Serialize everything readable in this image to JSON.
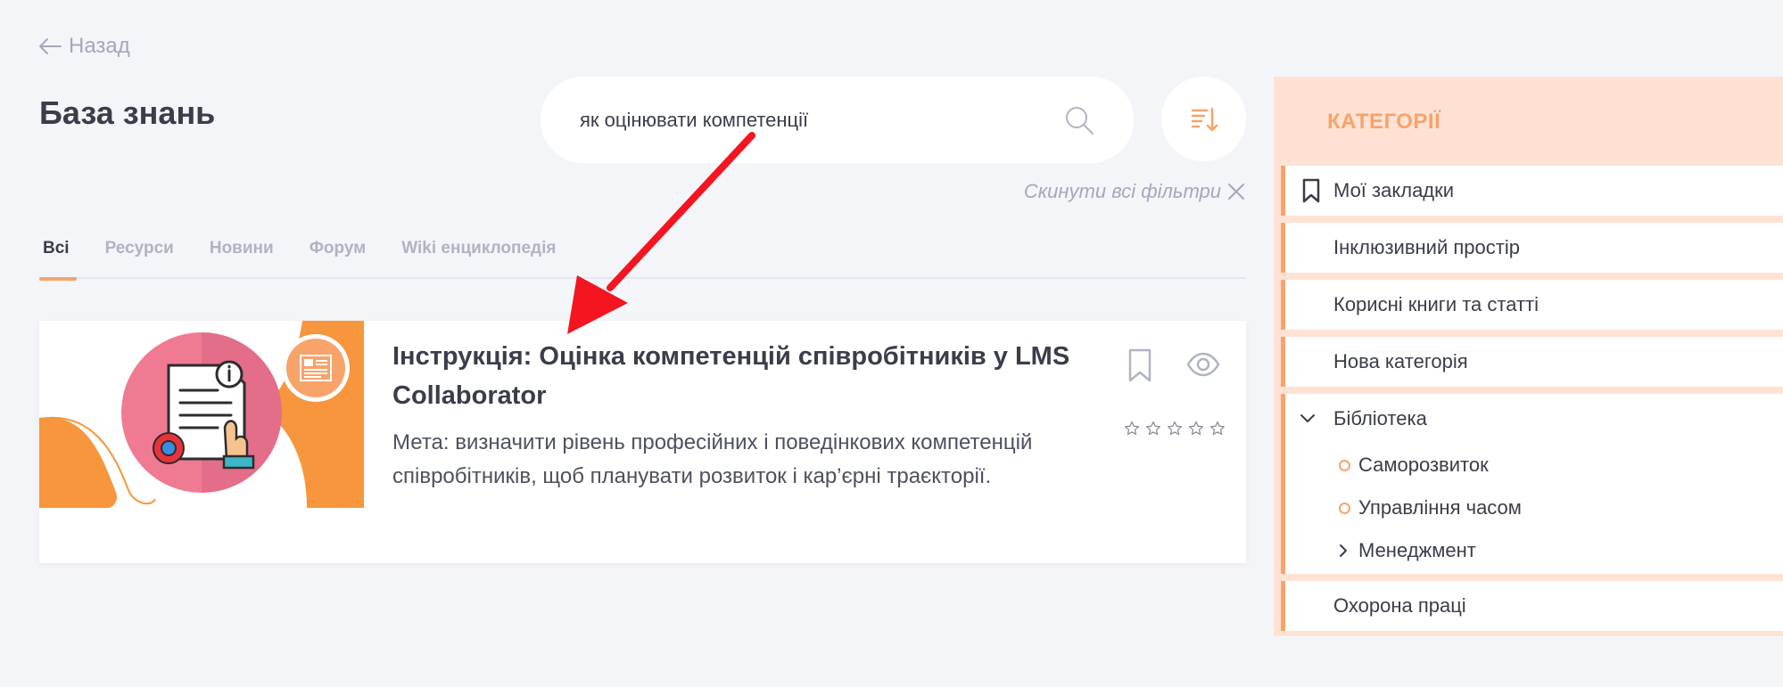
{
  "nav": {
    "back_label": "Назад"
  },
  "page": {
    "title": "База знань"
  },
  "search": {
    "value": "як оцінювати компетенції",
    "placeholder": ""
  },
  "filters": {
    "reset_label": "Скинути всі фільтри"
  },
  "tabs": [
    {
      "label": "Всі",
      "active": true
    },
    {
      "label": "Ресурси",
      "active": false
    },
    {
      "label": "Новини",
      "active": false
    },
    {
      "label": "Форум",
      "active": false
    },
    {
      "label": "Wiki енциклопедія",
      "active": false
    }
  ],
  "result": {
    "title": "Інструкція: Оцінка компетенцій співробітників у LMS Collaborator",
    "description": "Мета: визначити рівень професійних і поведінкових компетенцій співробітників, щоб планувати розвиток і кар’єрні траєкторії.",
    "rating": 0,
    "rating_max": 5,
    "type_icon": "article-icon"
  },
  "sidebar": {
    "title": "КАТЕГОРІЇ",
    "items": [
      {
        "label": "Мої закладки",
        "icon": "bookmark-icon"
      },
      {
        "label": "Інклюзивний простір"
      },
      {
        "label": "Корисні книги та статті"
      },
      {
        "label": "Нова категорія"
      },
      {
        "label": "Бібліотека",
        "icon": "chevron-down-icon",
        "children": [
          {
            "label": "Саморозвиток",
            "icon": "circle-icon"
          },
          {
            "label": "Управління часом",
            "icon": "circle-icon"
          },
          {
            "label": "Менеджмент",
            "icon": "chevron-right-icon"
          }
        ]
      },
      {
        "label": "Охорона праці"
      }
    ]
  },
  "colors": {
    "accent": "#f7a36a",
    "sidebar_bg": "#ffe2d4",
    "page_bg": "#f4f5f9",
    "annotation_arrow": "#f5141f"
  }
}
